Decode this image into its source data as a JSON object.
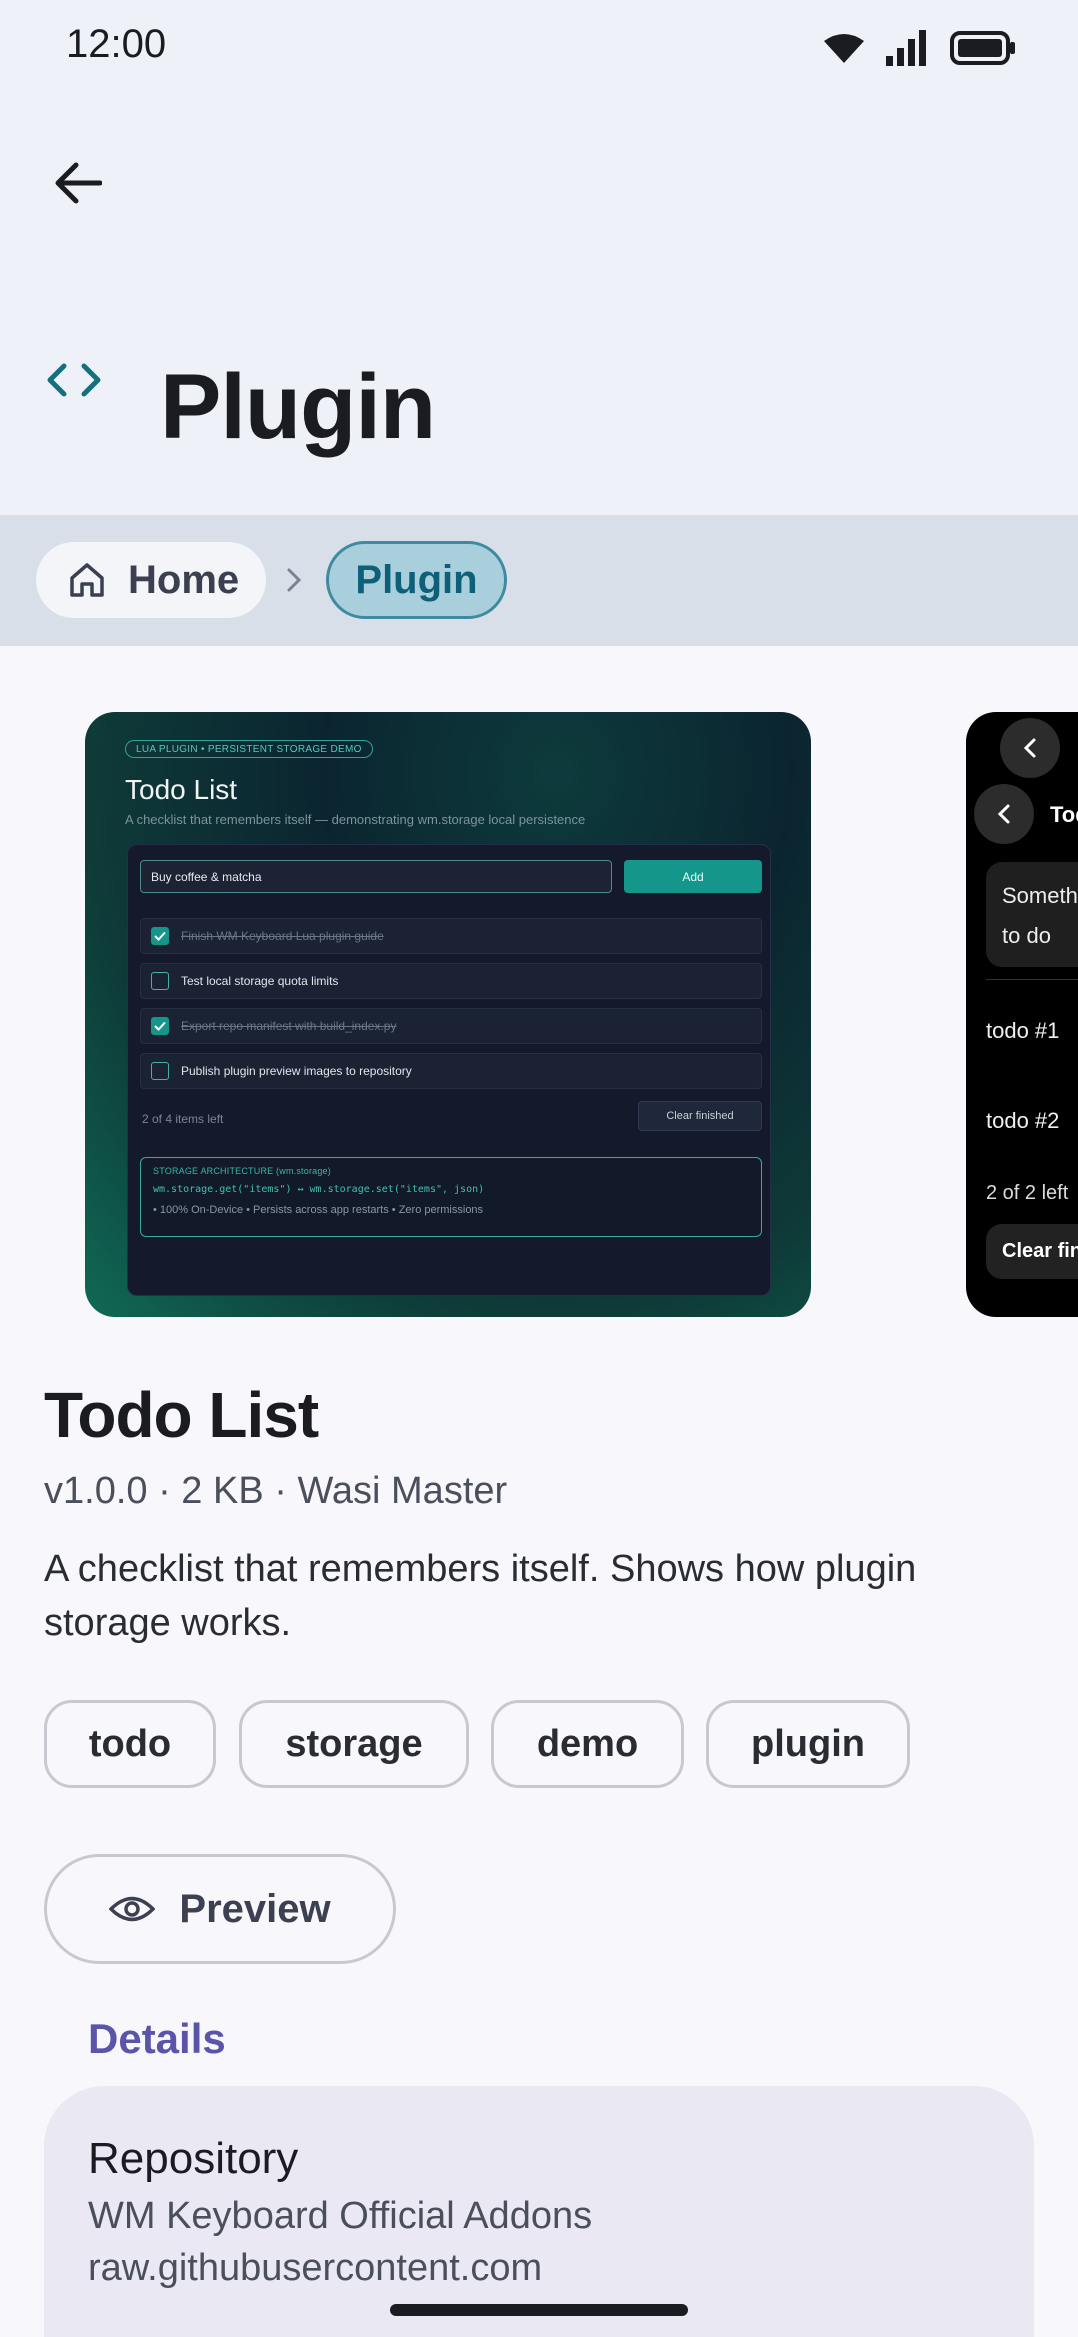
{
  "status_bar": {
    "time": "12:00"
  },
  "header": {
    "title": "Plugin"
  },
  "breadcrumb": {
    "home_label": "Home",
    "current_label": "Plugin"
  },
  "screenshot_1": {
    "badge": "LUA PLUGIN  •  PERSISTENT STORAGE DEMO",
    "title": "Todo List",
    "subtitle": "A checklist that remembers itself — demonstrating wm.storage local persistence",
    "input_value": "Buy coffee & matcha",
    "add_label": "Add",
    "items": [
      {
        "text": "Finish WM Keyboard Lua plugin guide",
        "done": true
      },
      {
        "text": "Test local storage quota limits",
        "done": false
      },
      {
        "text": "Export repo manifest with build_index.py",
        "done": true
      },
      {
        "text": "Publish plugin preview images to repository",
        "done": false
      }
    ],
    "items_left": "2 of 4 items left",
    "clear_label": "Clear finished",
    "arch_heading": "STORAGE ARCHITECTURE (wm.storage)",
    "arch_code": "wm.storage.get(\"items\")  ↔  wm.storage.set(\"items\", json)",
    "arch_footer": "• 100% On-Device  • Persists across app restarts  • Zero permissions"
  },
  "screenshot_2": {
    "title": "Todo",
    "input_text": "Something to do",
    "row1": "todo #1",
    "row2": "todo #2",
    "items_left": "2 of 2 left",
    "clear_label": "Clear finished"
  },
  "plugin": {
    "name": "Todo List",
    "meta": "v1.0.0 · 2 KB · Wasi Master",
    "description": "A checklist that remembers itself. Shows how plugin storage works."
  },
  "tags": [
    "todo",
    "storage",
    "demo",
    "plugin"
  ],
  "preview_label": "Preview",
  "details": {
    "heading": "Details",
    "repo_label": "Repository",
    "repo_name": "WM Keyboard Official Addons",
    "repo_host": "raw.githubusercontent.com"
  },
  "colors": {
    "accent": "#5a55a8",
    "breadcrumb_active_bg": "#a9cfdc",
    "teal": "#14978a"
  }
}
